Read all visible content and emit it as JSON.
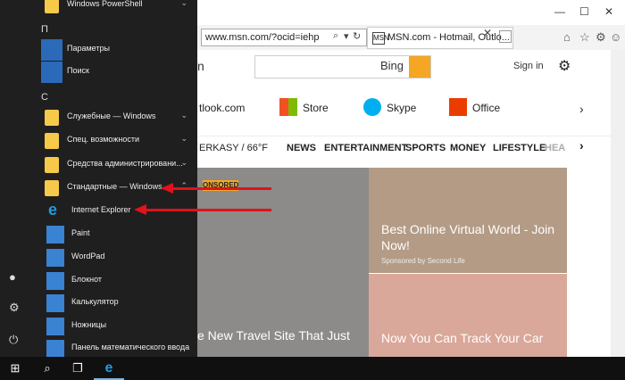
{
  "browser": {
    "address": "www.msn.com/?ocid=iehp",
    "tab_title": "MSN.com - Hotmail, Outlo...",
    "tab_favicon": "MSN",
    "page": {
      "logo": "n",
      "search_brand": "Bing",
      "signin": "Sign in",
      "quick_links": [
        "tlook.com",
        "Store",
        "Skype",
        "Office"
      ],
      "nav": [
        "ERKASY / 66°F",
        "NEWS",
        "ENTERTAINMENT",
        "SPORTS",
        "MONEY",
        "LIFESTYLE",
        "HEA"
      ],
      "hero": {
        "tag": "ONSORED",
        "caption": "e New Travel Site That Just"
      },
      "card1": {
        "title": "Best Online Virtual World - Join Now!",
        "sponsor": "Sponsored by Second Life"
      },
      "card2": {
        "title": "Now You Can Track Your Car"
      }
    }
  },
  "start_menu": {
    "top_item": "Windows PowerShell",
    "section_p": "П",
    "section_s": "С",
    "items_p": [
      "Параметры",
      "Поиск"
    ],
    "items_s": [
      "Служебные — Windows",
      "Спец. возможности",
      "Средства администрировани...",
      "Стандартные — Windows"
    ],
    "sub_items": [
      "Internet Explorer",
      "Paint",
      "WordPad",
      "Блокнот",
      "Калькулятор",
      "Ножницы",
      "Панель математического ввода"
    ]
  },
  "colors": {
    "accent": "#2b6ab8",
    "arrow": "#e0121c",
    "bing_button": "#f5a623"
  }
}
